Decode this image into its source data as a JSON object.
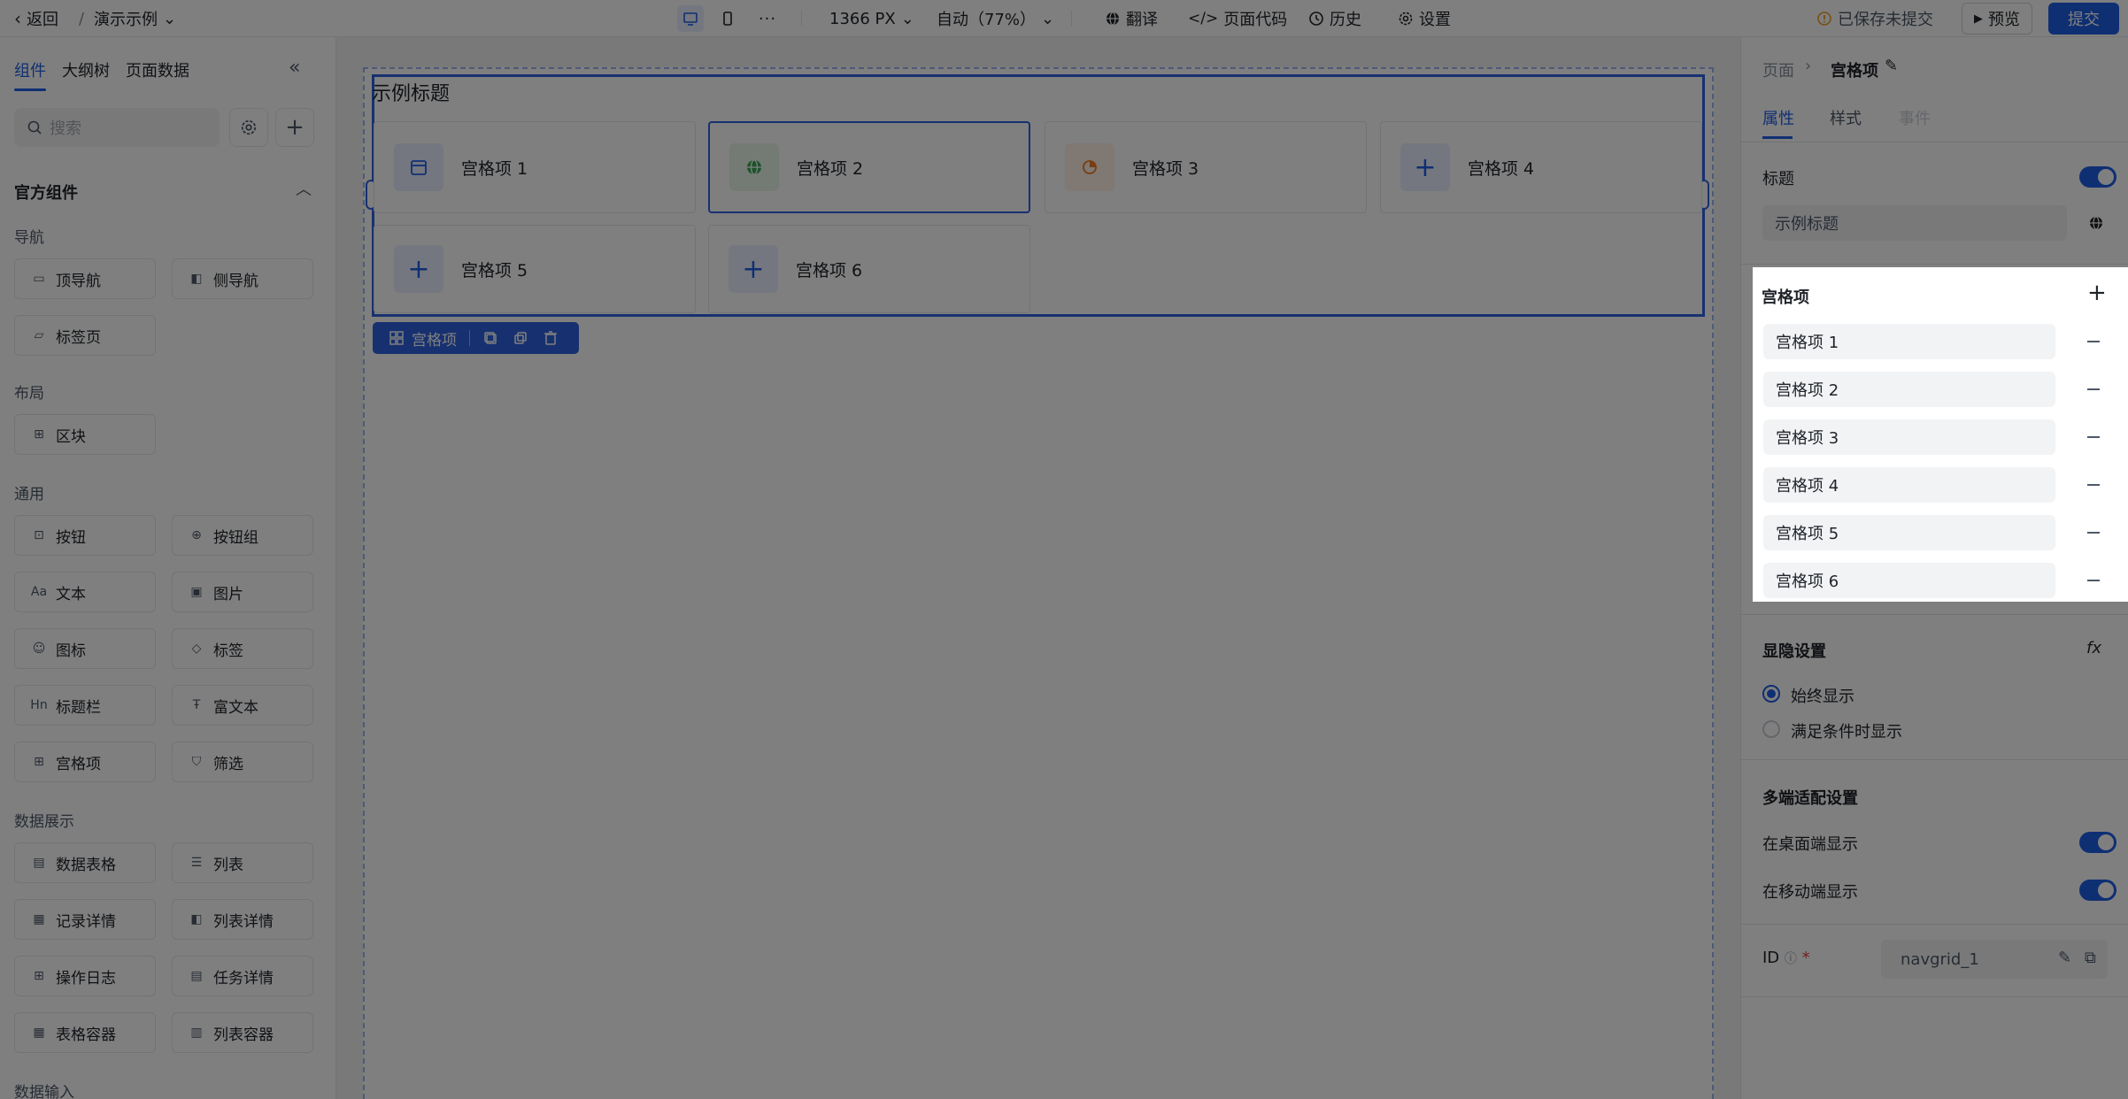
{
  "topbar": {
    "back_label": "返回",
    "sep": "/",
    "app_name": "演示示例",
    "width": "1366 PX",
    "zoom": "自动（77%）",
    "translate": "翻译",
    "page_code": "页面代码",
    "history": "历史",
    "settings": "设置",
    "save_status": "已保存未提交",
    "preview": "预览",
    "submit": "提交"
  },
  "left": {
    "tabs": [
      "组件",
      "大纲树",
      "页面数据"
    ],
    "search_placeholder": "搜索",
    "section": "官方组件",
    "groups": {
      "nav": "导航",
      "layout": "布局",
      "general": "通用",
      "display": "数据展示",
      "input": "数据输入"
    },
    "components": {
      "topnav": "顶导航",
      "sidenav": "侧导航",
      "tabs": "标签页",
      "block": "区块",
      "button": "按钮",
      "buttongroup": "按钮组",
      "text": "文本",
      "image": "图片",
      "icon": "图标",
      "tag": "标签",
      "titlebar": "标题栏",
      "richtext": "富文本",
      "grid": "宫格项",
      "filter": "筛选",
      "table": "数据表格",
      "list": "列表",
      "recorddetail": "记录详情",
      "listdetail": "列表详情",
      "oplog": "操作日志",
      "taskdetail": "任务详情",
      "tablecontainer": "表格容器",
      "listcontainer": "列表容器"
    }
  },
  "canvas": {
    "title": "示例标题",
    "items": [
      "宫格项 1",
      "宫格项 2",
      "宫格项 3",
      "宫格项 4",
      "宫格项 5",
      "宫格项 6"
    ],
    "selection_label": "宫格项"
  },
  "right": {
    "breadcrumb_root": "页面",
    "breadcrumb_current": "宫格项",
    "tabs": [
      "属性",
      "样式",
      "事件"
    ],
    "title_label": "标题",
    "title_value": "示例标题",
    "grid_label": "宫格项",
    "grid_items": [
      "宫格项 1",
      "宫格项 2",
      "宫格项 3",
      "宫格项 4",
      "宫格项 5",
      "宫格项 6"
    ],
    "visibility_label": "显隐设置",
    "fx": "fx",
    "always_show": "始终显示",
    "conditional_show": "满足条件时显示",
    "multi_label": "多端适配设置",
    "desktop_show": "在桌面端显示",
    "mobile_show": "在移动端显示",
    "id_label": "ID",
    "id_required": "*",
    "id_value": "navgrid_1"
  },
  "colors": {
    "accent": "#1e5ee6",
    "selection": "#2f63e0",
    "warning": "#f0a020"
  }
}
